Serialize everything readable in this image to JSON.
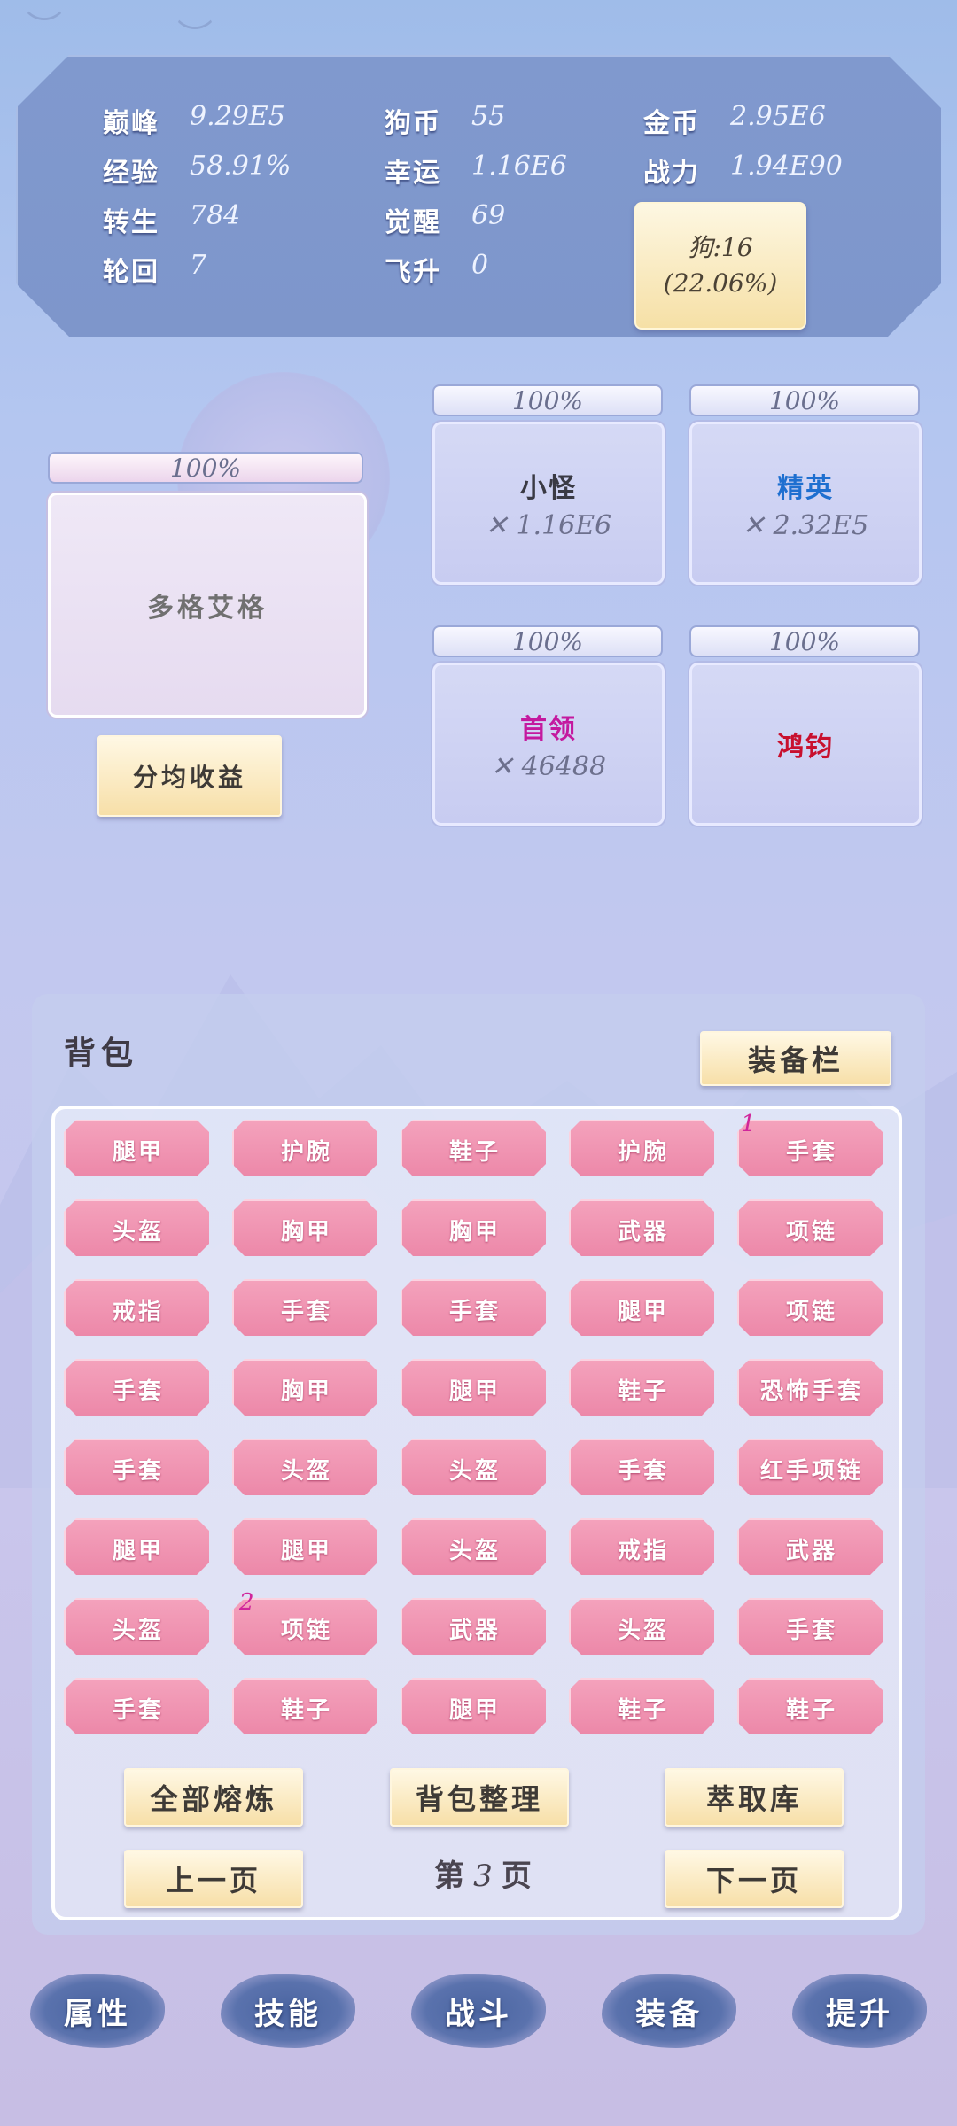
{
  "stats": {
    "labels": {
      "peak": "巅峰",
      "exp": "经验",
      "rebirth": "转生",
      "cycle": "轮回",
      "dog_coin": "狗币",
      "luck": "幸运",
      "awaken": "觉醒",
      "ascend": "飞升",
      "gold": "金币",
      "power": "战力"
    },
    "values": {
      "peak": "9.29E5",
      "exp": "58.91%",
      "rebirth": "784",
      "cycle": "7",
      "dog_coin": "55",
      "luck": "1.16E6",
      "awaken": "69",
      "ascend": "0",
      "gold": "2.95E6",
      "power": "1.94E90"
    },
    "dog_card": {
      "line1": "狗:16",
      "line2": "(22.06%)"
    }
  },
  "monsters": {
    "main": {
      "percent": "100%",
      "name": "多格艾格"
    },
    "share_button": "分均收益",
    "small": {
      "percent": "100%",
      "name": "小怪",
      "count": "✕ 1.16E6",
      "color": "#3a3a44"
    },
    "elite": {
      "percent": "100%",
      "name": "精英",
      "count": "✕ 2.32E5",
      "color": "#1e6fd0"
    },
    "boss": {
      "percent": "100%",
      "name": "首领",
      "count": "✕ 46488",
      "color": "#c4199f"
    },
    "hongjun": {
      "percent": "100%",
      "name": "鸿钧",
      "color": "#c8102e"
    }
  },
  "backpack": {
    "title": "背包",
    "equip_button": "装备栏",
    "items": [
      [
        "腿甲",
        "护腕",
        "鞋子",
        "护腕",
        "手套"
      ],
      [
        "头盔",
        "胸甲",
        "胸甲",
        "武器",
        "项链"
      ],
      [
        "戒指",
        "手套",
        "手套",
        "腿甲",
        "项链"
      ],
      [
        "手套",
        "胸甲",
        "腿甲",
        "鞋子",
        "恐怖手套"
      ],
      [
        "手套",
        "头盔",
        "头盔",
        "手套",
        "红手项链"
      ],
      [
        "腿甲",
        "腿甲",
        "头盔",
        "戒指",
        "武器"
      ],
      [
        "头盔",
        "项链",
        "武器",
        "头盔",
        "手套"
      ],
      [
        "手套",
        "鞋子",
        "腿甲",
        "鞋子",
        "鞋子"
      ]
    ],
    "badges": {
      "r0c4": "1",
      "r6c1": "2"
    },
    "smelt_all": "全部熔炼",
    "organize": "背包整理",
    "extract": "萃取库",
    "prev_page": "上一页",
    "next_page": "下一页",
    "page_prefix": "第",
    "page_number": "3",
    "page_suffix": "页"
  },
  "nav": [
    "属性",
    "技能",
    "战斗",
    "装备",
    "提升"
  ]
}
